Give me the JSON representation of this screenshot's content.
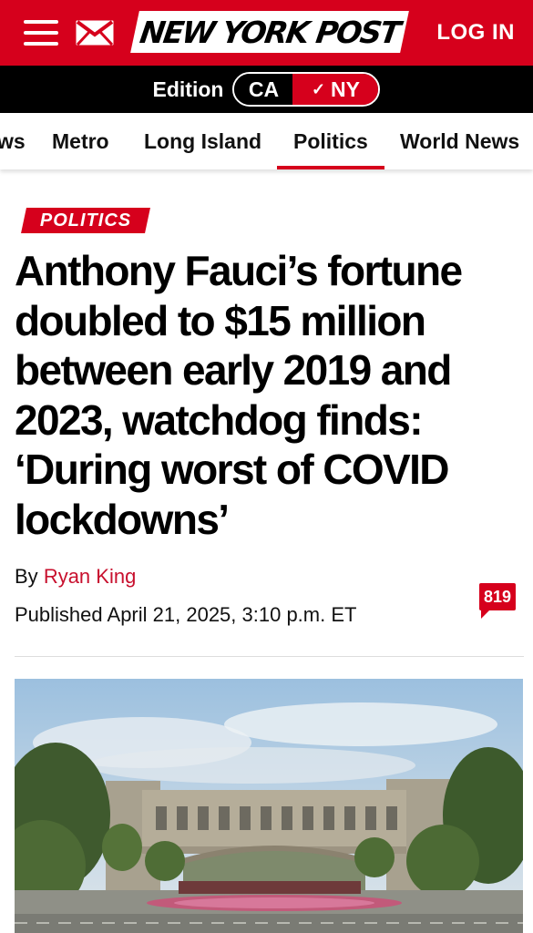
{
  "header": {
    "logo_text": "NEW YORK POST",
    "login_label": "LOG IN",
    "brand_color": "#d6001c",
    "icons": [
      "hamburger-menu-icon",
      "mail-icon"
    ]
  },
  "edition": {
    "label": "Edition",
    "options": [
      "CA",
      "NY"
    ],
    "selected": "NY",
    "selected_check": "✓"
  },
  "sections": [
    {
      "label": "ws",
      "active": false
    },
    {
      "label": "Metro",
      "active": false
    },
    {
      "label": "Long Island",
      "active": false
    },
    {
      "label": "Politics",
      "active": true
    },
    {
      "label": "World News",
      "active": false
    }
  ],
  "article": {
    "kicker": "POLITICS",
    "headline_lines": [
      "Anthony Fauci’s fortune",
      "doubled to $15 million",
      "between early 2019 and",
      "2023, watchdog finds:",
      "‘During worst of COVID",
      "lockdowns’"
    ],
    "byline_prefix": "By",
    "author": "Ryan King",
    "published": "Published April 21, 2025, 3:10 p.m. ET",
    "comment_count": "819"
  }
}
